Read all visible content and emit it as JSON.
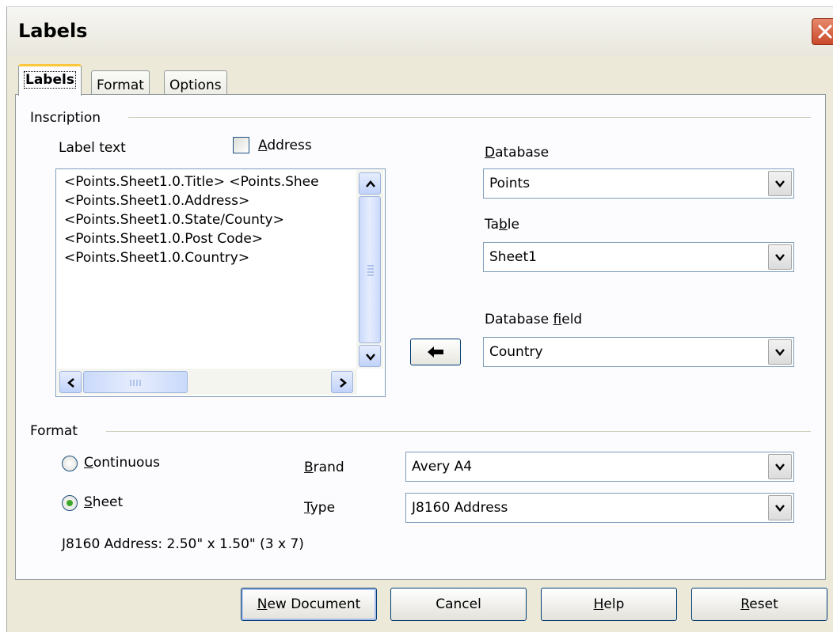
{
  "window": {
    "title": "Labels"
  },
  "tabs": [
    {
      "label": "Labels",
      "active": true
    },
    {
      "label": "Format",
      "active": false
    },
    {
      "label": "Options",
      "active": false
    }
  ],
  "inscription": {
    "group_label": "Inscription",
    "label_text_label": "Label text",
    "address_checkbox": {
      "label": "Address",
      "checked": false
    },
    "label_text_lines": [
      "<Points.Sheet1.0.Title> <Points.Shee",
      "<Points.Sheet1.0.Address>",
      "<Points.Sheet1.0.State/County>",
      "<Points.Sheet1.0.Post Code>",
      "<Points.Sheet1.0.Country>"
    ],
    "database": {
      "label": "Database",
      "value": "Points"
    },
    "table": {
      "label": "Table",
      "value": "Sheet1"
    },
    "database_field": {
      "label": "Database field",
      "value": "Country"
    }
  },
  "format": {
    "group_label": "Format",
    "continuous": {
      "label": "Continuous",
      "selected": false
    },
    "sheet": {
      "label": "Sheet",
      "selected": true
    },
    "brand": {
      "label": "Brand",
      "value": "Avery A4"
    },
    "type": {
      "label": "Type",
      "value": "J8160 Address"
    },
    "summary": "J8160 Address: 2.50\" x 1.50\" (3 x 7)"
  },
  "buttons": {
    "new_document": "New Document",
    "cancel": "Cancel",
    "help": "Help",
    "reset": "Reset"
  },
  "colors": {
    "dialog_bg": "#ece9d8",
    "active_tab_accent": "#ffc83c",
    "close_button": "#c94a2a",
    "radio_selected": "#3ea82b",
    "input_border": "#7f9db9"
  }
}
